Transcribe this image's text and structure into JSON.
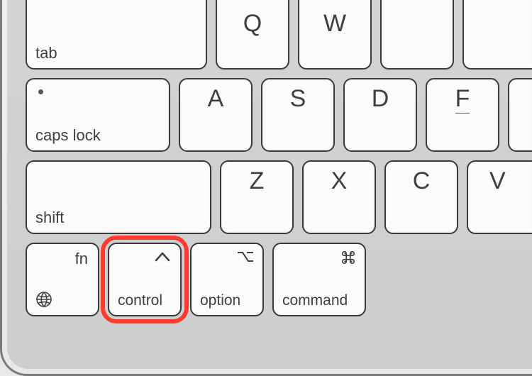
{
  "keyboard": {
    "labels": {
      "tab": "tab",
      "caps_lock": "caps lock",
      "shift": "shift",
      "fn": "fn",
      "control": "control",
      "option": "option",
      "command": "command",
      "Q": "Q",
      "W": "W",
      "A": "A",
      "S": "S",
      "D": "D",
      "F": "F",
      "Z": "Z",
      "X": "X",
      "C": "C",
      "V": "V"
    },
    "icons": {
      "globe": "globe-icon",
      "control_caret": "caret-up-icon",
      "option_symbol": "option-symbol-icon",
      "command_symbol": "command-symbol-icon"
    },
    "highlight": "control"
  }
}
